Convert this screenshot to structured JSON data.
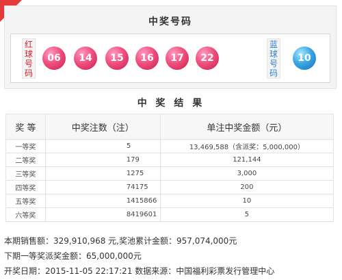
{
  "draw": {
    "title": "中奖号码",
    "red_label": "红球号码",
    "blue_label": "蓝球号码",
    "red_balls": [
      "06",
      "14",
      "15",
      "16",
      "17",
      "22"
    ],
    "blue_ball": "10"
  },
  "results": {
    "title": "中 奖 结 果",
    "headers": {
      "level": "奖 等",
      "count": "中奖注数（注）",
      "amount": "单注中奖金额（元）"
    },
    "rows": [
      {
        "level": "一等奖",
        "count": "5",
        "amount": "13,469,588（含派奖：5,000,000）"
      },
      {
        "level": "二等奖",
        "count": "179",
        "amount": "121,144"
      },
      {
        "level": "三等奖",
        "count": "1275",
        "amount": "3,000"
      },
      {
        "level": "四等奖",
        "count": "74175",
        "amount": "200"
      },
      {
        "level": "五等奖",
        "count": "1415866",
        "amount": "10"
      },
      {
        "level": "六等奖",
        "count": "8419601",
        "amount": "5"
      }
    ]
  },
  "info": {
    "sales": "本期销售额：329,910,968 元,奖池累计金额：957,074,000元",
    "next_first_prize": "下期一等奖派奖金额：65,000,000元",
    "draw_date": "开奖日期：2015-11-05 22:17:21 数据来源：中国福利彩票发行管理中心"
  },
  "colors": {
    "corner": "#e53a3a",
    "red_ball": "#e84b7a",
    "blue_ball": "#39a8e4",
    "red_label": "#d8202c",
    "blue_label": "#2e7fd1"
  }
}
